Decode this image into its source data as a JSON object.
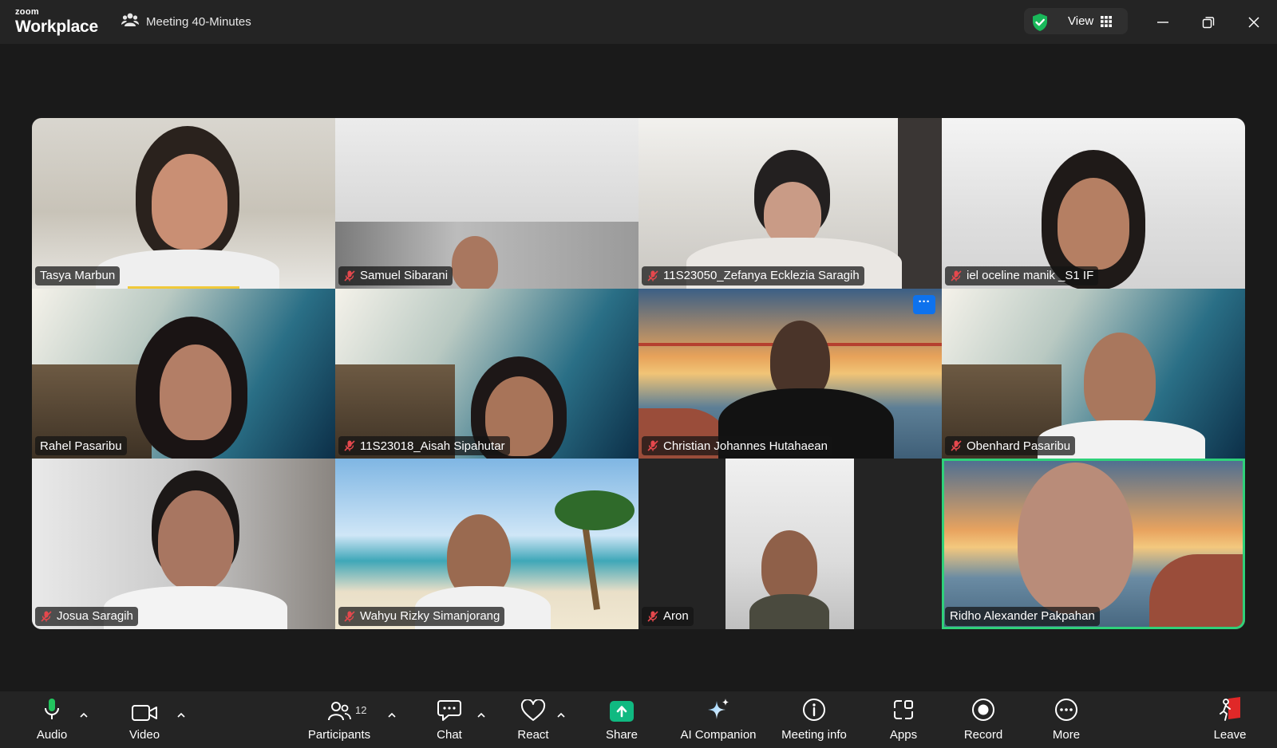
{
  "app": {
    "brand_top": "zoom",
    "brand_bottom": "Workplace"
  },
  "meeting": {
    "title": "Meeting 40-Minutes"
  },
  "header": {
    "view_label": "View"
  },
  "participants": [
    {
      "name": "Tasya Marbun",
      "muted": false,
      "speaking_indicator": true
    },
    {
      "name": "Samuel Sibarani",
      "muted": true
    },
    {
      "name": "11S23050_Zefanya Ecklezia Saragih",
      "muted": true
    },
    {
      "name": "iel oceline manik _S1 IF",
      "muted": true
    },
    {
      "name": "Rahel Pasaribu",
      "muted": false
    },
    {
      "name": "11S23018_Aisah Sipahutar",
      "muted": true
    },
    {
      "name": "Christian Johannes Hutahaean",
      "muted": true,
      "more_menu": "···"
    },
    {
      "name": "Obenhard Pasaribu",
      "muted": true
    },
    {
      "name": "Josua Saragih",
      "muted": true
    },
    {
      "name": "Wahyu Rizky Simanjorang",
      "muted": true
    },
    {
      "name": "Aron",
      "muted": true
    },
    {
      "name": "Ridho Alexander Pakpahan",
      "muted": false,
      "active_speaker": true
    }
  ],
  "toolbar": {
    "audio": "Audio",
    "video": "Video",
    "participants": "Participants",
    "participants_count": "12",
    "chat": "Chat",
    "react": "React",
    "share": "Share",
    "ai_companion": "AI Companion",
    "meeting_info": "Meeting info",
    "apps": "Apps",
    "record": "Record",
    "more": "More",
    "leave": "Leave"
  },
  "colors": {
    "background": "#1a1a1a",
    "bar": "#242424",
    "share_green": "#10b981",
    "active_speaker_border": "#2fd17a",
    "muted_red": "#e5484d",
    "leave_red": "#e02828"
  }
}
